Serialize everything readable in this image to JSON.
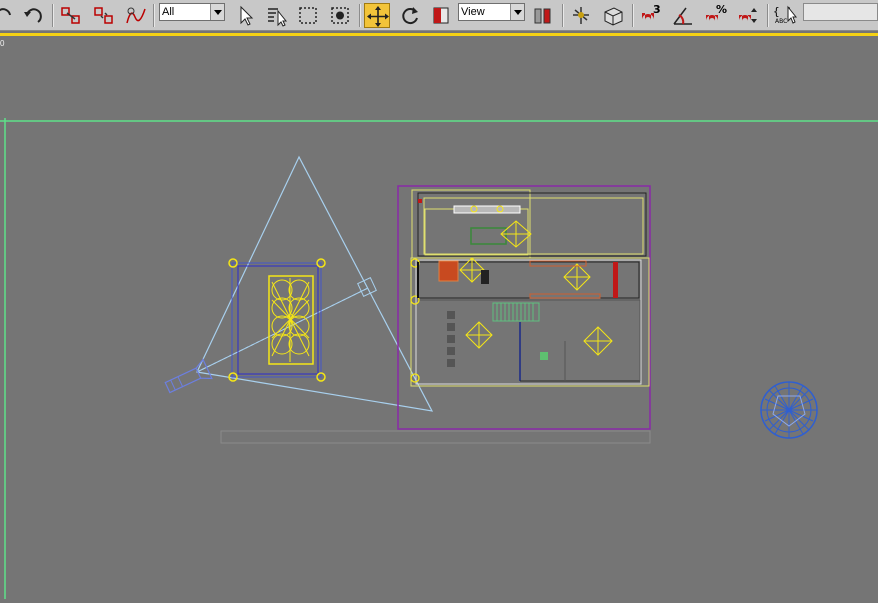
{
  "toolbar": {
    "filter_select": {
      "value": "All"
    },
    "ref_coord_select": {
      "value": "View"
    },
    "snap_3_label": "3",
    "percent_snap_label": "%",
    "named_sel_label": "{ }",
    "abc_label": "ABC"
  },
  "viewport": {
    "label": "0"
  },
  "colors": {
    "toolbar_bg": "#c8c8c8",
    "active_tool": "#f2c43a",
    "viewport_bg": "#757575",
    "highlight_line": "#f5d214",
    "grid_line": "#5ee28a",
    "camera": "#a8d0ee",
    "selection_yellow": "#f5e616",
    "bounds_purple": "#8a2aa8",
    "geosphere": "#2f5fd0"
  }
}
